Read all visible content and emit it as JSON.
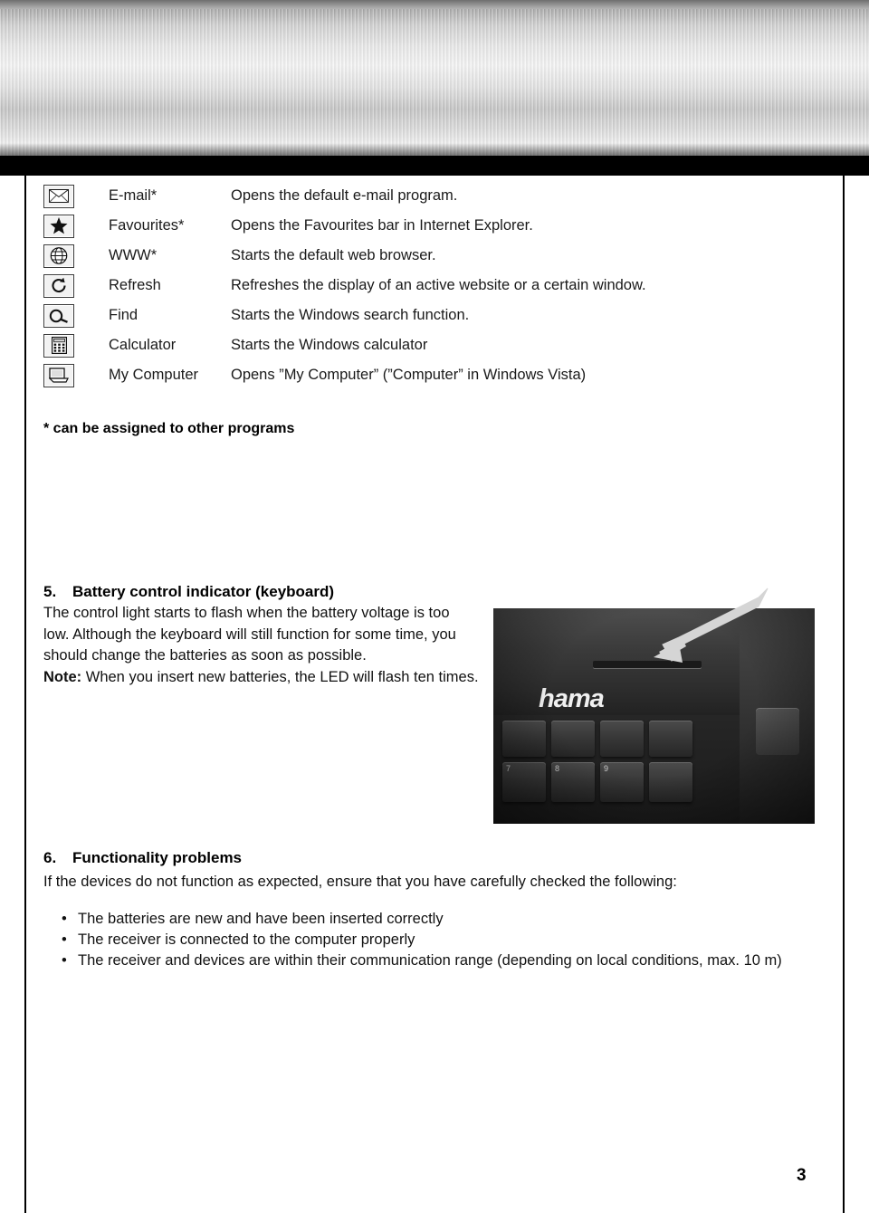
{
  "banner": {
    "alt": "brushed-metal-header-band"
  },
  "feature_table": {
    "rows": [
      {
        "icon": "email-icon",
        "name": "E-mail*",
        "desc": "Opens the default e-mail program."
      },
      {
        "icon": "star-icon",
        "name": "Favourites*",
        "desc": "Opens the Favourites bar in Internet Explorer."
      },
      {
        "icon": "globe-icon",
        "name": "WWW*",
        "desc": "Starts the default web browser."
      },
      {
        "icon": "refresh-icon",
        "name": "Refresh",
        "desc": "Refreshes the display of an active website or a certain window."
      },
      {
        "icon": "search-icon",
        "name": "Find",
        "desc": "Starts the Windows search function."
      },
      {
        "icon": "calculator-icon",
        "name": "Calculator",
        "desc": "Starts the Windows calculator"
      },
      {
        "icon": "computer-icon",
        "name": "My Computer",
        "desc": "Opens ”My Computer” (”Computer” in Windows Vista)"
      }
    ],
    "footnote": "* can be assigned to other programs"
  },
  "section5": {
    "number": "5.",
    "title": "Battery control indicator (keyboard)",
    "line1": "The control light starts to flash when the battery voltage is too",
    "line2": "low. Although the keyboard will still function for some time, you",
    "line3": "should change the batteries as soon as possible.",
    "note_label": "Note:",
    "note_text": " When you insert new batteries, the LED will flash ten times.",
    "photo_logo": "hama",
    "photo_keys": [
      "7",
      "8",
      "9"
    ]
  },
  "section6": {
    "number": "6.",
    "title": "Functionality problems",
    "intro": "If the devices do not function as expected, ensure that you have carefully checked the following:",
    "bullets": [
      "The batteries are new and have been inserted correctly",
      "The receiver is connected to the computer properly",
      "The receiver and devices are within their communication range (depending on local conditions, max. 10 m)"
    ],
    "bullet_marker": "•"
  },
  "footer": {
    "page_number": "3"
  }
}
